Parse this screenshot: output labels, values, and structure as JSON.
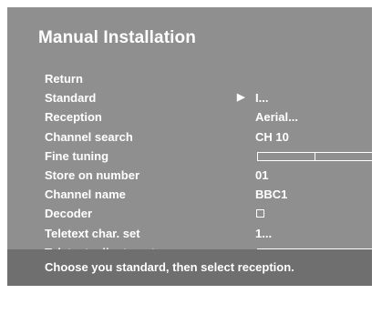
{
  "screen": {
    "title": "Manual Installation",
    "footer_hint": "Choose you standard, then select reception."
  },
  "colors": {
    "panel_background": "#8f8f8f",
    "footer_background": "#6f6f6f",
    "text": "#ffffff"
  },
  "menu": {
    "items": [
      {
        "label": "Return",
        "value": ""
      },
      {
        "label": "Standard",
        "value": "I...",
        "selected": true,
        "indicator_icon": "play-arrow-icon"
      },
      {
        "label": "Reception",
        "value": "Aerial..."
      },
      {
        "label": "Channel search",
        "value": "CH 10"
      },
      {
        "label": "Fine tuning",
        "control": "bar"
      },
      {
        "label": "Store on number",
        "value": "01"
      },
      {
        "label": "Channel name",
        "value": "BBC1"
      },
      {
        "label": "Decoder",
        "control": "checkbox",
        "checked": false
      },
      {
        "label": "Teletext char. set",
        "value": "1..."
      },
      {
        "label": "Teletext adjustment",
        "control": "bar"
      }
    ]
  }
}
